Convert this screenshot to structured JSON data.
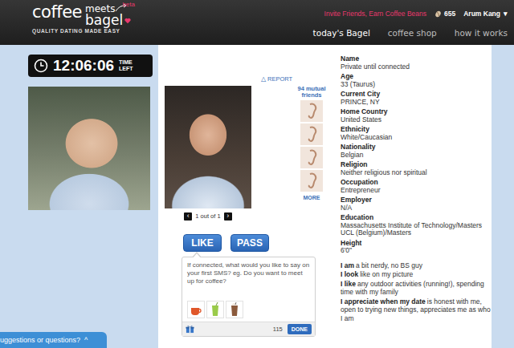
{
  "header": {
    "logo": {
      "coffee": "coffee",
      "meets": "meets",
      "bagel": "bagel",
      "beta": "beta",
      "tagline": "QUALITY DATING MADE EASY"
    },
    "invite": "Invite Friends, Earn Coffee Beans",
    "beans": "655",
    "user": "Arum Kang",
    "user_caret": "▾"
  },
  "nav": [
    {
      "label": "today's Bagel",
      "selected": true
    },
    {
      "label": "coffee shop",
      "selected": false
    },
    {
      "label": "how it works",
      "selected": false
    }
  ],
  "timer": {
    "time": "12:06:06",
    "unit_top": "TIME",
    "unit_bottom": "LEFT"
  },
  "gallery": {
    "report_icon": "△",
    "report": "REPORT",
    "pager": {
      "prev": "‹",
      "label": "1 out of 1",
      "next": "›"
    }
  },
  "mutual": {
    "count": "94",
    "label": "mutual friends",
    "more": "MORE"
  },
  "actions": [
    {
      "label": "LIKE"
    },
    {
      "label": "PASS"
    }
  ],
  "message": {
    "placeholder": "If connected, what would you like to say on your first SMS? eg. Do you want to meet up for coffee?",
    "count": "115",
    "done": "DONE"
  },
  "profile": {
    "fields": [
      {
        "label": "Name",
        "value": [
          "Private until connected"
        ]
      },
      {
        "label": "Age",
        "value": [
          "33 (Taurus)"
        ]
      },
      {
        "label": "Current City",
        "value": [
          "PRINCE, NY"
        ]
      },
      {
        "label": "Home Country",
        "value": [
          "United States"
        ]
      },
      {
        "label": "Ethnicity",
        "value": [
          "White/Caucasian"
        ]
      },
      {
        "label": "Nationality",
        "value": [
          "Belgian"
        ]
      },
      {
        "label": "Religion",
        "value": [
          "Neither religious nor spiritual"
        ]
      },
      {
        "label": "Occupation",
        "value": [
          "Entrepreneur"
        ]
      },
      {
        "label": "Employer",
        "value": [
          "N/A"
        ]
      },
      {
        "label": "Education",
        "value": [
          "Massachusetts Institute of Technology/Masters",
          "UCL (Belgium)/Masters"
        ]
      },
      {
        "label": "Height",
        "value": [
          "6'0\""
        ]
      }
    ],
    "about": [
      {
        "lead": "I am",
        "text": "a bit nerdy, no BS guy"
      },
      {
        "lead": "I look",
        "text": "like on my picture"
      },
      {
        "lead": "I like",
        "text": "any outdoor activities (running!), spending time with my family"
      },
      {
        "lead": "I appreciate when my date",
        "text": "is honest with me, open to trying new things, appreciates me as who I am"
      }
    ]
  },
  "feedback": {
    "label": "uggestions or questions?",
    "caret": "^"
  }
}
